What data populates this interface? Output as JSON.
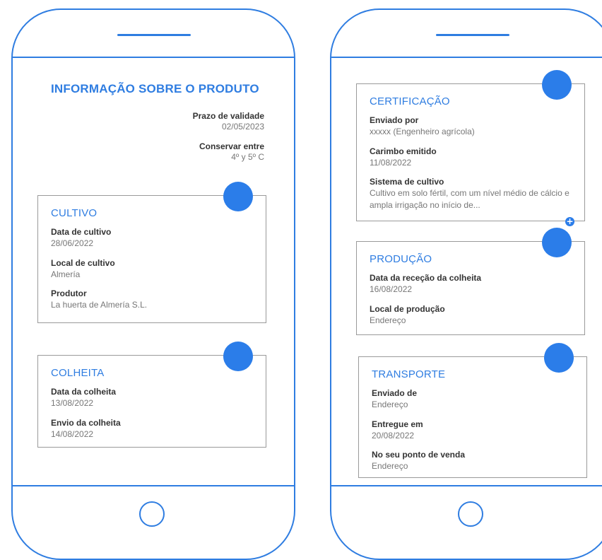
{
  "left": {
    "title": "INFORMAÇÃO SOBRE O PRODUTO",
    "meta": [
      {
        "label": "Prazo de validade",
        "value": "02/05/2023"
      },
      {
        "label": "Conservar entre",
        "value": "4º y 5º C"
      }
    ],
    "cultivo": {
      "title": "CULTIVO",
      "fields": [
        {
          "label": "Data de cultivo",
          "value": "28/06/2022"
        },
        {
          "label": "Local de cultivo",
          "value": "Almería"
        },
        {
          "label": "Produtor",
          "value": "La huerta de Almería S.L."
        }
      ]
    },
    "colheita": {
      "title": "COLHEITA",
      "fields": [
        {
          "label": "Data da colheita",
          "value": "13/08/2022"
        },
        {
          "label": "Envio da colheita",
          "value": "14/08/2022"
        }
      ]
    }
  },
  "right": {
    "certificacao": {
      "title": "CERTIFICAÇÃO",
      "fields": [
        {
          "label": "Enviado por",
          "value": "xxxxx (Engenheiro agrícola)"
        },
        {
          "label": "Carimbo emitido",
          "value": "11/08/2022"
        },
        {
          "label": "Sistema de cultivo",
          "value": "Cultivo em solo fértil, com um nível médio de cálcio e ampla irrigação no início de..."
        }
      ],
      "expand_icon": "+"
    },
    "producao": {
      "title": "PRODUÇÃO",
      "fields": [
        {
          "label": "Data da receção da colheita",
          "value": "16/08/2022"
        },
        {
          "label": "Local de produção",
          "value": "Endereço"
        }
      ]
    },
    "transporte": {
      "title": "TRANSPORTE",
      "fields": [
        {
          "label": "Enviado de",
          "value": "Endereço"
        },
        {
          "label": "Entregue em",
          "value": "20/08/2022"
        },
        {
          "label": "No seu ponto de venda",
          "value": "Endereço"
        }
      ]
    }
  },
  "colors": {
    "accent": "#2f7de1",
    "dot": "#2b7de9",
    "border": "#9a9a9a"
  }
}
